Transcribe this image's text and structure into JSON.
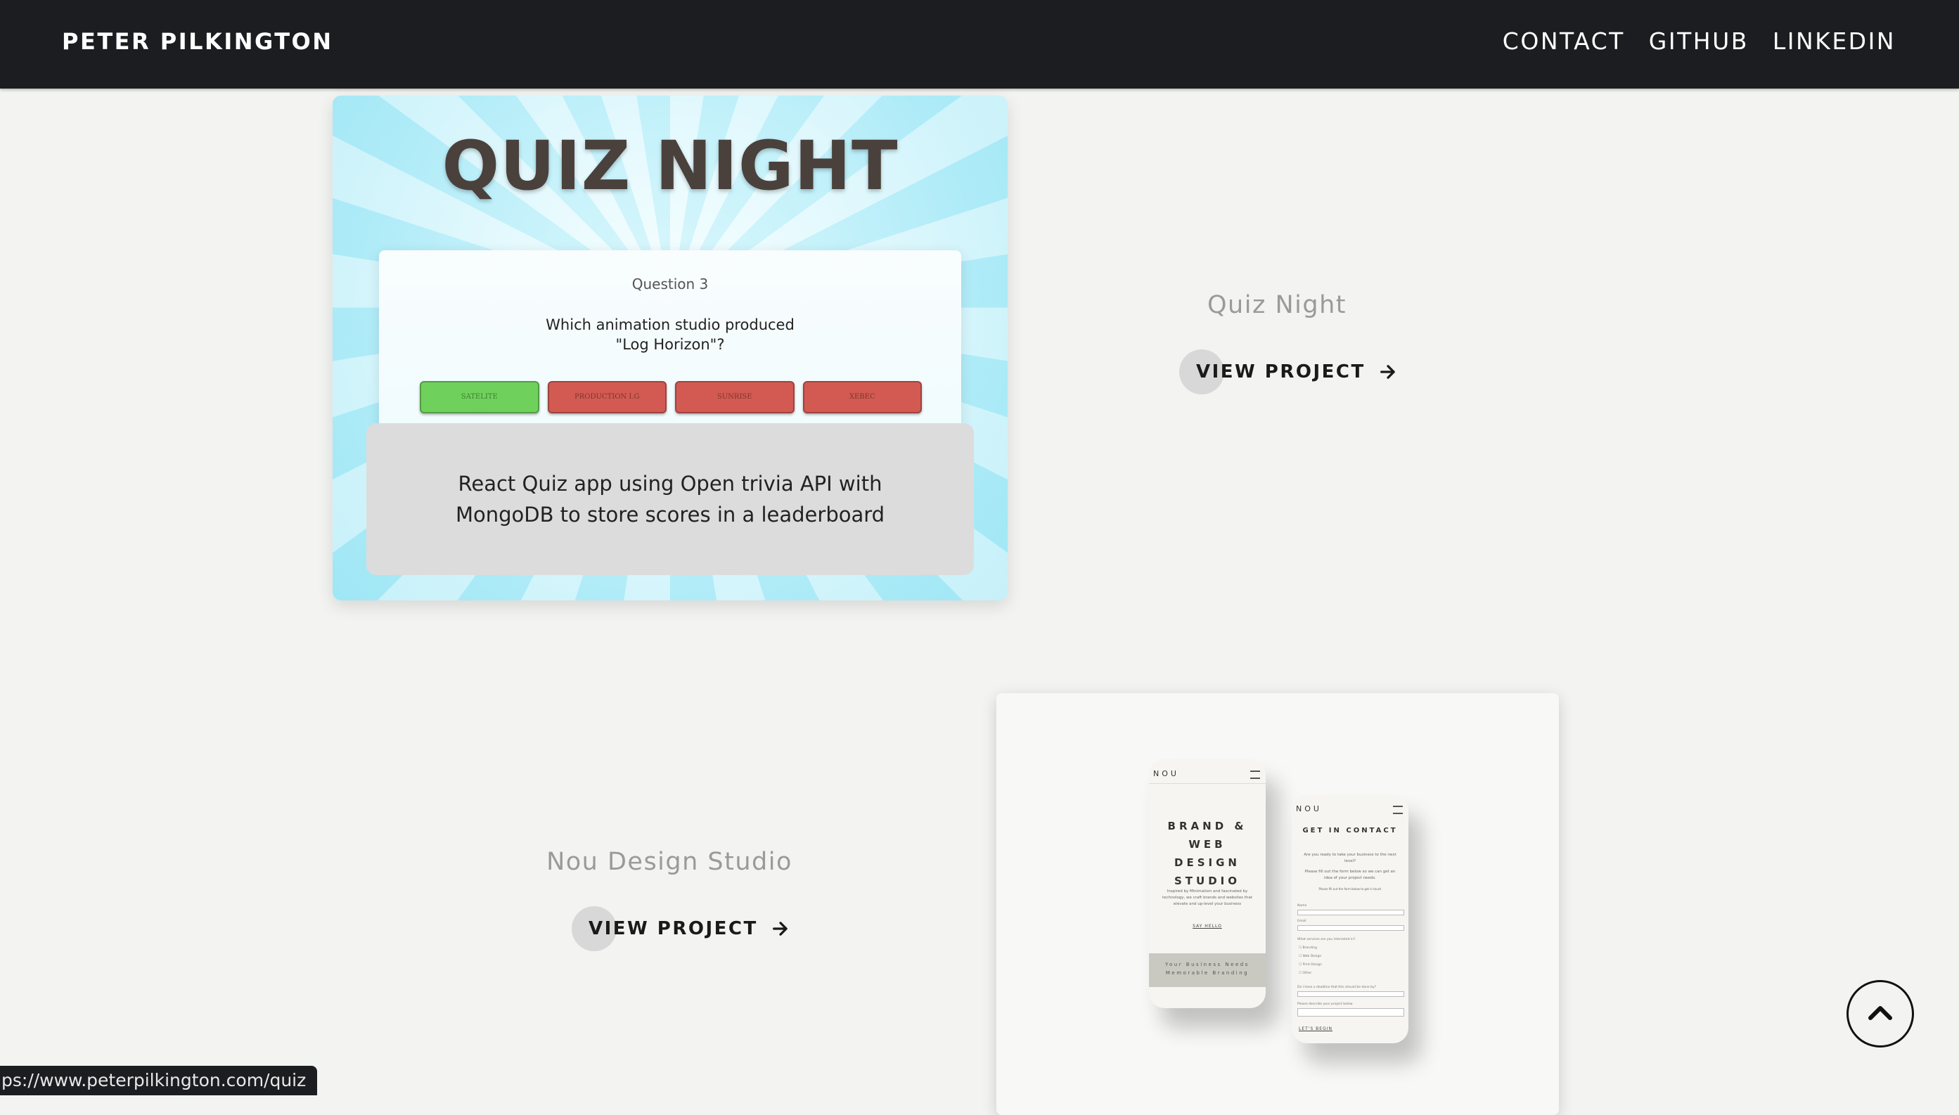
{
  "header": {
    "brand": "PETER PILKINGTON",
    "nav": [
      "CONTACT",
      "GITHUB",
      "LINKEDIN"
    ]
  },
  "projects": [
    {
      "title": "Quiz Night",
      "cta": "VIEW PROJECT",
      "description": "React Quiz app using Open trivia API with MongoDB to store scores in a leaderboard",
      "screenshot": {
        "heading": "QUIZ NIGHT",
        "question_number": "Question 3",
        "question": "Which animation studio produced \"Log Horizon\"?",
        "answers": [
          {
            "label": "SATELITE",
            "state": "correct"
          },
          {
            "label": "PRODUCTION I.G",
            "state": "wrong"
          },
          {
            "label": "SUNRISE",
            "state": "wrong"
          },
          {
            "label": "XEBEC",
            "state": "wrong"
          }
        ]
      }
    },
    {
      "title": "Nou Design Studio",
      "cta": "VIEW PROJECT",
      "screenshot": {
        "phone_a": {
          "logo": "NOU",
          "headline": "BRAND & WEB DESIGN STUDIO",
          "body": "Inspired by Minimalism and fascinated by technology, we craft brands and websites that elevate and up-level your business",
          "link": "SAY HELLO",
          "footer": "Your Business Needs Memorable Branding"
        },
        "phone_b": {
          "logo": "NOU",
          "headline": "GET IN CONTACT",
          "intro": "Are you ready to take your business to the next level?",
          "sub": "Please fill out the form below so we can get an idea of your project needs.",
          "note": "Please fill out the form below to get in touch",
          "field_labels": [
            "Name",
            "Email"
          ],
          "question": "What services are you interested in?",
          "options": [
            "Branding",
            "Web Design",
            "Print Design",
            "Other"
          ],
          "deadline": "Do I have a deadline that this should be done by?",
          "describe": "Please describe your project below",
          "link": "LET'S BEGIN"
        }
      }
    }
  ],
  "status_bar": {
    "url": "ps://www.peterpilkington.com/quiz"
  },
  "scroll_top": {
    "icon": "chevron-up-icon"
  },
  "colors": {
    "header_bg": "#1c1d21",
    "page_bg": "#f3f4f2",
    "correct": "#6fd15b",
    "wrong": "#d35a52",
    "overlay": "#dcdcdc"
  }
}
